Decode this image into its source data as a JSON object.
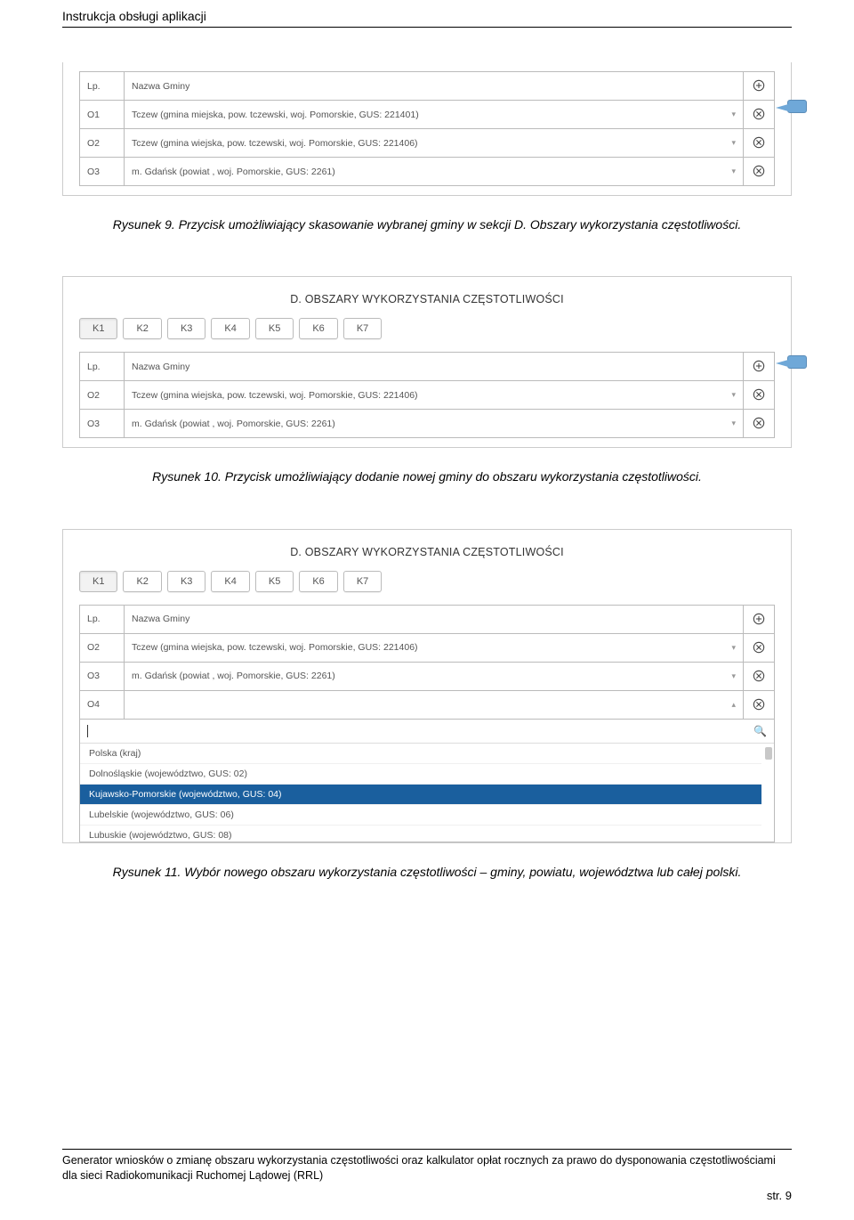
{
  "header": {
    "title": "Instrukcja obsługi aplikacji"
  },
  "fig9": {
    "cols": {
      "lp": "Lp.",
      "name": "Nazwa Gminy"
    },
    "rows": [
      {
        "lp": "O1",
        "name": "Tczew (gmina miejska, pow. tczewski, woj. Pomorskie, GUS: 221401)"
      },
      {
        "lp": "O2",
        "name": "Tczew (gmina wiejska, pow. tczewski, woj. Pomorskie, GUS: 221406)"
      },
      {
        "lp": "O3",
        "name": "m. Gdańsk (powiat , woj. Pomorskie, GUS: 2261)"
      }
    ],
    "caption": "Rysunek 9. Przycisk umożliwiający skasowanie wybranej gminy w sekcji D. Obszary wykorzystania częstotliwości."
  },
  "section_d_title": "D. OBSZARY WYKORZYSTANIA CZĘSTOTLIWOŚCI",
  "tabs": [
    "K1",
    "K2",
    "K3",
    "K4",
    "K5",
    "K6",
    "K7"
  ],
  "fig10": {
    "cols": {
      "lp": "Lp.",
      "name": "Nazwa Gminy"
    },
    "rows": [
      {
        "lp": "O2",
        "name": "Tczew (gmina wiejska, pow. tczewski, woj. Pomorskie, GUS: 221406)"
      },
      {
        "lp": "O3",
        "name": "m. Gdańsk (powiat , woj. Pomorskie, GUS: 2261)"
      }
    ],
    "caption": "Rysunek 10. Przycisk umożliwiający dodanie nowej gminy do obszaru wykorzystania częstotliwości."
  },
  "fig11": {
    "cols": {
      "lp": "Lp.",
      "name": "Nazwa Gminy"
    },
    "rows": [
      {
        "lp": "O2",
        "name": "Tczew (gmina wiejska, pow. tczewski, woj. Pomorskie, GUS: 221406)"
      },
      {
        "lp": "O3",
        "name": "m. Gdańsk (powiat , woj. Pomorskie, GUS: 2261)"
      },
      {
        "lp": "O4",
        "name": ""
      }
    ],
    "dropdown": {
      "items": [
        {
          "label": "Polska (kraj)",
          "selected": false
        },
        {
          "label": "Dolnośląskie (województwo, GUS: 02)",
          "selected": false
        },
        {
          "label": "Kujawsko-Pomorskie (województwo, GUS: 04)",
          "selected": true
        },
        {
          "label": "Lubelskie (województwo, GUS: 06)",
          "selected": false
        },
        {
          "label": "Lubuskie (województwo, GUS: 08)",
          "selected": false
        }
      ]
    },
    "caption": "Rysunek 11. Wybór nowego obszaru wykorzystania częstotliwości – gminy, powiatu, województwa lub całej polski."
  },
  "footer": {
    "text": "Generator wniosków o zmianę obszaru wykorzystania częstotliwości oraz kalkulator opłat rocznych za prawo do dysponowania częstotliwościami dla sieci Radiokomunikacji Ruchomej Lądowej (RRL)",
    "page": "str. 9"
  },
  "icons": {
    "caret_down": "▾",
    "caret_up": "▴",
    "search": "🔍"
  }
}
